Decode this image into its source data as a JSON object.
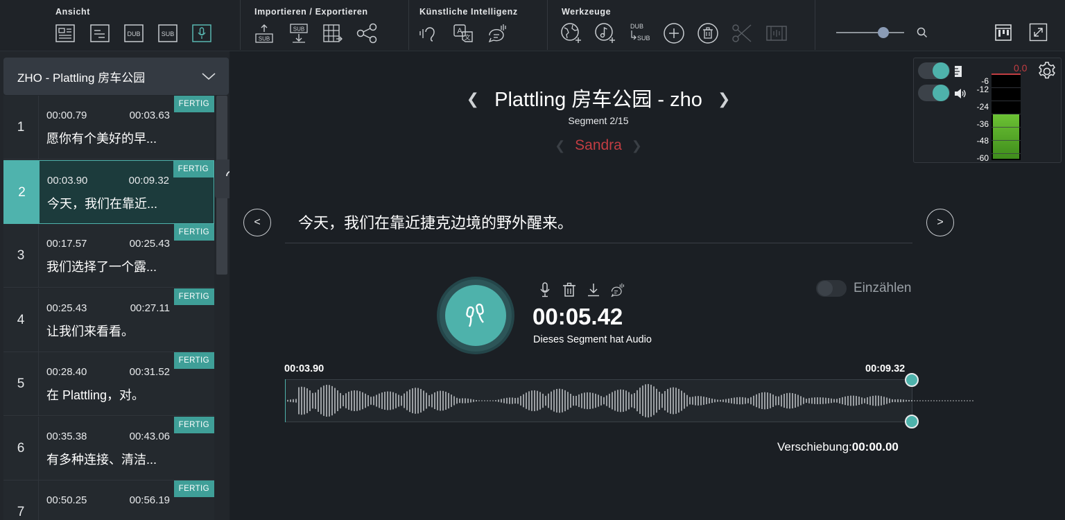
{
  "toolbar": {
    "groups": [
      {
        "title": "Ansicht",
        "buttons": [
          "layout-icon",
          "list-icon",
          "dub-view",
          "sub-view",
          "mic-view"
        ]
      },
      {
        "title": "Importieren / Exportieren",
        "buttons": [
          "import-sub",
          "export-sub",
          "table-export",
          "share"
        ]
      },
      {
        "title": "Künstliche Intelligenz",
        "buttons": [
          "ai-listen",
          "ai-translate",
          "ai-voice"
        ]
      },
      {
        "title": "Werkzeuge",
        "buttons": [
          "globe-add",
          "music-add",
          "dub-to-sub",
          "add",
          "delete",
          "cut",
          "film"
        ]
      }
    ],
    "labels": {
      "dub": "DUB",
      "sub": "SUB",
      "zoom_level": 0.75
    }
  },
  "sidebar": {
    "language_select": "ZHO - Plattling 房车公园",
    "status_label": "FERTIG",
    "segments": [
      {
        "num": "1",
        "start": "00:00.79",
        "end": "00:03.63",
        "text": "愿你有个美好的早...",
        "active": false
      },
      {
        "num": "2",
        "start": "00:03.90",
        "end": "00:09.32",
        "text": "今天，我们在靠近...",
        "active": true
      },
      {
        "num": "3",
        "start": "00:17.57",
        "end": "00:25.43",
        "text": "我们选择了一个露...",
        "active": false
      },
      {
        "num": "4",
        "start": "00:25.43",
        "end": "00:27.11",
        "text": "让我们来看看。",
        "active": false
      },
      {
        "num": "5",
        "start": "00:28.40",
        "end": "00:31.52",
        "text": "在 Plattling，对。",
        "active": false
      },
      {
        "num": "6",
        "start": "00:35.38",
        "end": "00:43.06",
        "text": "有多种连接、清洁...",
        "active": false
      },
      {
        "num": "7",
        "start": "00:50.25",
        "end": "00:56.19",
        "text": "",
        "active": false
      }
    ]
  },
  "main": {
    "title": "Plattling 房车公园 - zho",
    "segment_counter": "Segment 2/15",
    "speaker": "Sandra",
    "segment_text": "今天，我们在靠近捷克边境的野外醒来。",
    "duration": "00:05.42",
    "duration_note": "Dieses Segment hat Audio",
    "count_in_label": "Einzählen",
    "wave_start": "00:03.90",
    "wave_end": "00:09.32",
    "offset_label": "Verschiebung:",
    "offset_value": "00:00.00"
  },
  "meter": {
    "peak": "0.0",
    "scale": [
      "-6",
      "-12",
      "-24",
      "-36",
      "-48",
      "-60"
    ],
    "level_fraction": 0.53
  },
  "colors": {
    "accent": "#4eb2ab",
    "speaker": "#c23d42",
    "meter_green": "#5aa82e"
  }
}
